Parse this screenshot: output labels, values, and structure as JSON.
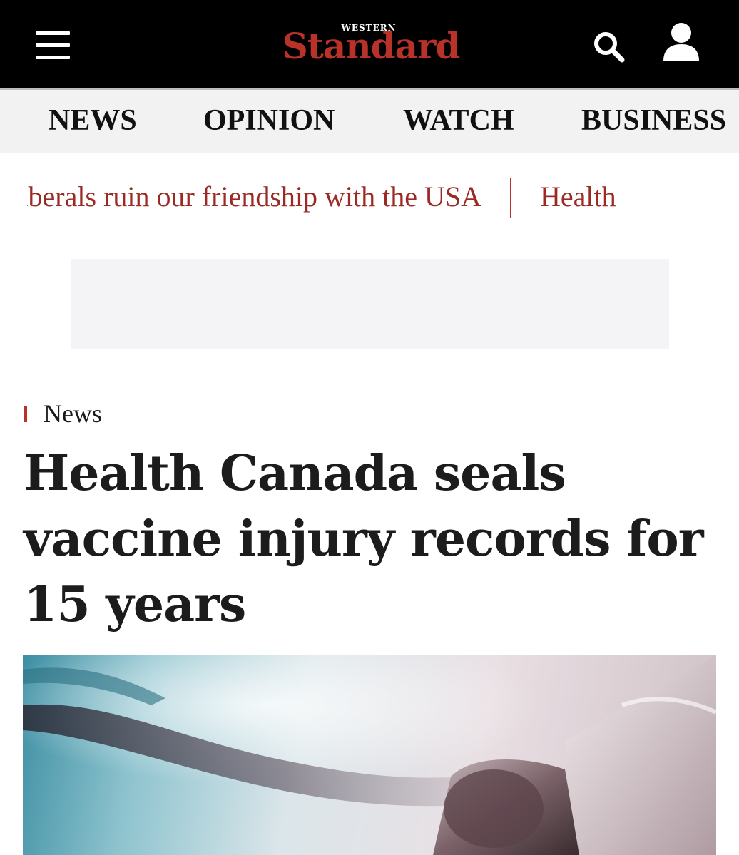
{
  "header": {
    "logo_small": "WESTERN",
    "logo_main": "Standard",
    "menu_icon": "hamburger-menu-icon",
    "search_icon": "search-icon",
    "account_icon": "user-account-icon",
    "brand_red": "#b8322a"
  },
  "nav": {
    "items": [
      {
        "label": "NEWS"
      },
      {
        "label": "OPINION"
      },
      {
        "label": "WATCH"
      },
      {
        "label": "BUSINESS"
      }
    ]
  },
  "ticker": {
    "items": [
      {
        "label": "Liberals ruin our friendship with the USA"
      },
      {
        "label": "Health"
      }
    ]
  },
  "article": {
    "category": "News",
    "headline": "Health Canada seals vaccine injury records for 15 years",
    "hero_image": "vaccine vial and syringe photo"
  }
}
